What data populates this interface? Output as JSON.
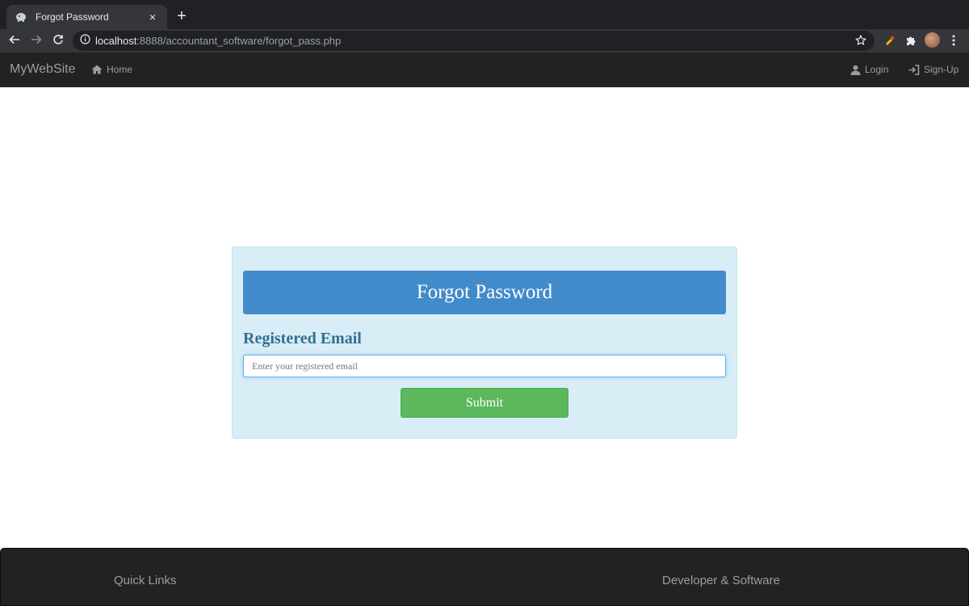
{
  "browser": {
    "tab_title": "Forgot Password",
    "tab_close": "×",
    "new_tab": "+",
    "url_host": "localhost",
    "url_rest": ":8888/accountant_software/forgot_pass.php",
    "icons": {
      "favicon": "elephant-icon",
      "back": "arrow-left-icon",
      "forward": "arrow-right-icon",
      "reload": "reload-icon",
      "site_info": "info-icon",
      "bookmark": "star-icon",
      "extension_1": "extension-icon",
      "extensions": "puzzle-icon",
      "profile": "avatar",
      "menu": "more-vertical-icon"
    }
  },
  "navbar": {
    "brand": "MyWebSite",
    "home": "Home",
    "login": "Login",
    "signup": "Sign-Up",
    "icons": {
      "home": "home-icon",
      "login": "user-icon",
      "signup": "sign-in-icon"
    }
  },
  "form": {
    "heading": "Forgot Password",
    "email_label": "Registered Email",
    "email_placeholder": "Enter your registered email",
    "email_value": "",
    "submit_label": "Submit"
  },
  "footer": {
    "quick_links": "Quick Links",
    "developer": "Developer & Software"
  },
  "colors": {
    "panel_bg": "#d9edf7",
    "heading_bg": "#428bca",
    "label_color": "#31708f",
    "submit_bg": "#5cb85c",
    "navbar_bg": "#222222"
  }
}
